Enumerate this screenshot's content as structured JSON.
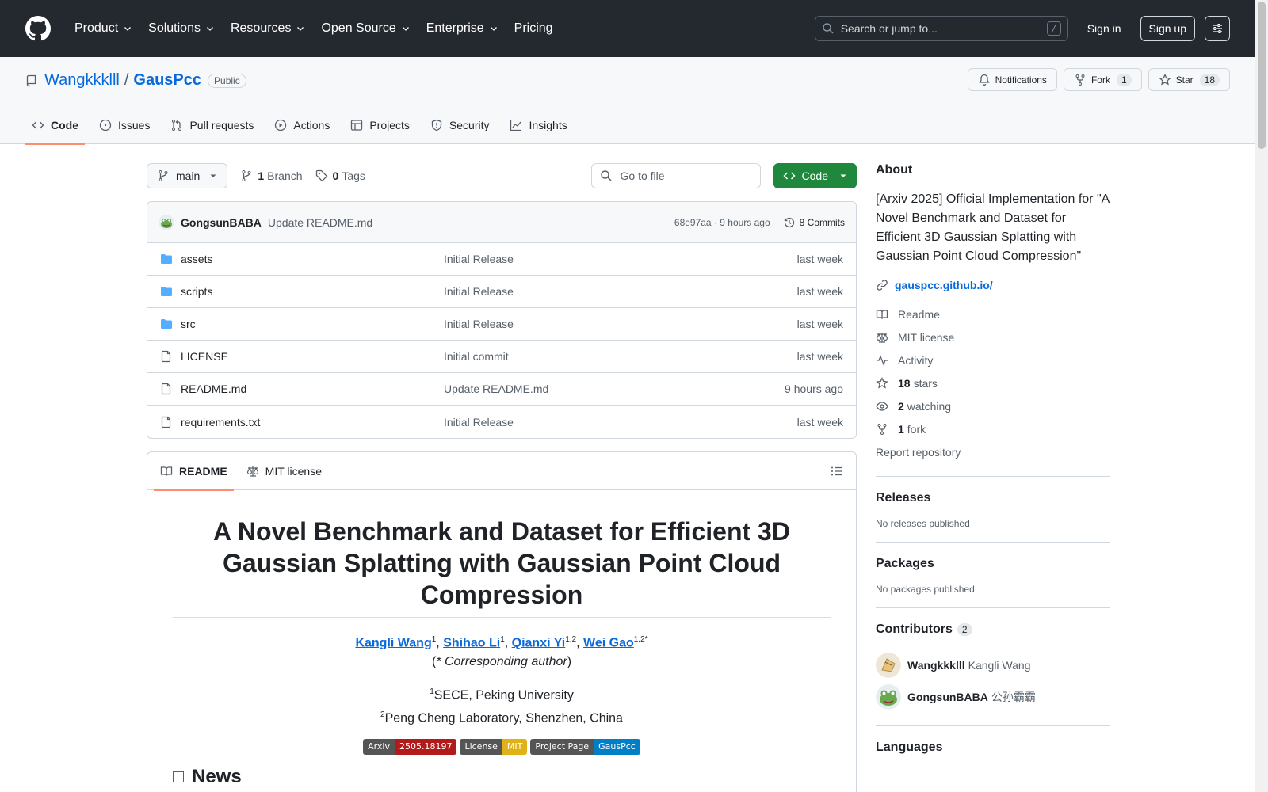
{
  "header": {
    "nav": [
      "Product",
      "Solutions",
      "Resources",
      "Open Source",
      "Enterprise",
      "Pricing"
    ],
    "search_placeholder": "Search or jump to...",
    "search_shortcut": "/",
    "sign_in": "Sign in",
    "sign_up": "Sign up"
  },
  "repo": {
    "owner": "Wangkkklll",
    "separator": "/",
    "name": "GausPcc",
    "visibility": "Public",
    "notifications_label": "Notifications",
    "fork_label": "Fork",
    "fork_count": "1",
    "star_label": "Star",
    "star_count": "18",
    "tabs": [
      "Code",
      "Issues",
      "Pull requests",
      "Actions",
      "Projects",
      "Security",
      "Insights"
    ]
  },
  "toolbar": {
    "branch": "main",
    "branch_count": "1",
    "branch_label": "Branch",
    "tag_count": "0",
    "tag_label": "Tags",
    "goto_placeholder": "Go to file",
    "code_button": "Code"
  },
  "commit": {
    "author": "GongsunBABA",
    "message": "Update README.md",
    "meta": "68e97aa · 9 hours ago",
    "commits_label": "8 Commits"
  },
  "files": [
    {
      "name": "assets",
      "type": "folder",
      "message": "Initial Release",
      "date": "last week"
    },
    {
      "name": "scripts",
      "type": "folder",
      "message": "Initial Release",
      "date": "last week"
    },
    {
      "name": "src",
      "type": "folder",
      "message": "Initial Release",
      "date": "last week"
    },
    {
      "name": "LICENSE",
      "type": "file",
      "message": "Initial commit",
      "date": "last week"
    },
    {
      "name": "README.md",
      "type": "file",
      "message": "Update README.md",
      "date": "9 hours ago"
    },
    {
      "name": "requirements.txt",
      "type": "file",
      "message": "Initial Release",
      "date": "last week"
    }
  ],
  "readme": {
    "tab_readme": "README",
    "tab_license": "MIT license",
    "title": "A Novel Benchmark and Dataset for Efficient 3D Gaussian Splatting with Gaussian Point Cloud Compression",
    "authors": [
      {
        "name": "Kangli Wang",
        "sup": "1"
      },
      {
        "name": "Shihao Li",
        "sup": "1"
      },
      {
        "name": "Qianxi Yi",
        "sup": "1,2"
      },
      {
        "name": "Wei Gao",
        "sup": "1,2*"
      }
    ],
    "corresponding_star": "(",
    "corresponding_text": "* Corresponding author",
    "corresponding_end": ")",
    "affiliations": [
      {
        "sup": "1",
        "text": "SECE, Peking University"
      },
      {
        "sup": "2",
        "text": "Peng Cheng Laboratory, Shenzhen, China"
      }
    ],
    "badges": [
      {
        "left": "Arxiv",
        "right": "2505.18197",
        "color": "#b31b1b"
      },
      {
        "left": "License",
        "right": "MIT",
        "color": "#dfb317"
      },
      {
        "left": "Project Page",
        "right": "GausPcc",
        "color": "#007ec6"
      }
    ],
    "news_heading": "News"
  },
  "sidebar": {
    "about_heading": "About",
    "about_text": "[Arxiv 2025] Official Implementation for \"A Novel Benchmark and Dataset for Efficient 3D Gaussian Splatting with Gaussian Point Cloud Compression\"",
    "homepage": "gauspcc.github.io/",
    "readme": "Readme",
    "license": "MIT license",
    "activity": "Activity",
    "stars_count": "18",
    "stars_label": "stars",
    "watching_count": "2",
    "watching_label": "watching",
    "fork_count": "1",
    "fork_label": "fork",
    "report": "Report repository",
    "releases_heading": "Releases",
    "releases_text": "No releases published",
    "packages_heading": "Packages",
    "packages_text": "No packages published",
    "contributors_heading": "Contributors",
    "contributors_count": "2",
    "contributors": [
      {
        "login": "Wangkkklll",
        "name": "Kangli Wang"
      },
      {
        "login": "GongsunBABA",
        "name": "公孙霸霸"
      }
    ],
    "languages_heading": "Languages"
  }
}
